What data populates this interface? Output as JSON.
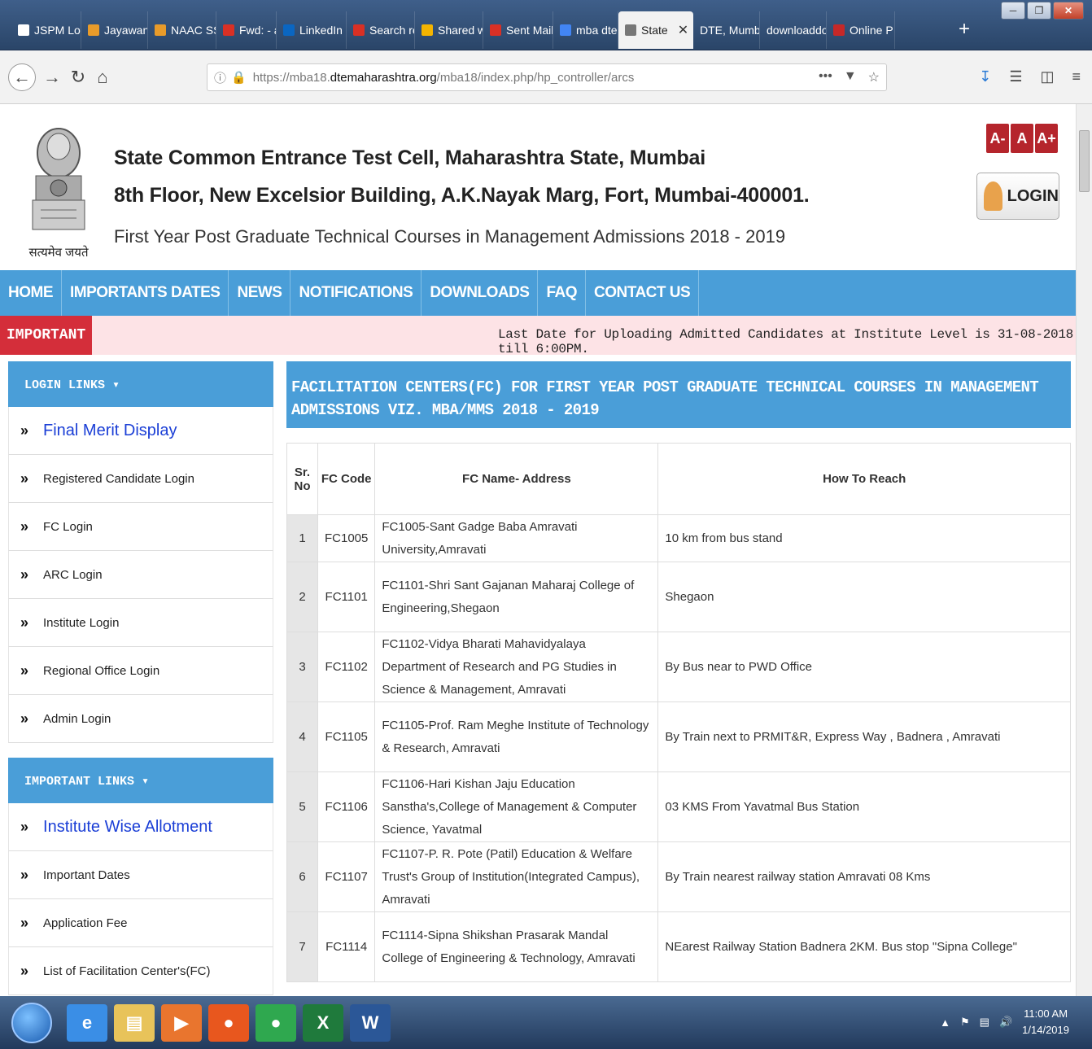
{
  "browser": {
    "tabs": [
      {
        "label": "JSPM Login P",
        "icon": "page-icon",
        "color": "#ffffff"
      },
      {
        "label": "Jayawant",
        "icon": "jayawant-logo-icon",
        "color": "#e89b2a"
      },
      {
        "label": "NAAC SS",
        "icon": "naac-logo-icon",
        "color": "#e89b2a"
      },
      {
        "label": "Fwd: - ad",
        "icon": "gmail-icon",
        "color": "#d93025"
      },
      {
        "label": "LinkedIn",
        "icon": "linkedin-icon",
        "color": "#0a66c2"
      },
      {
        "label": "Search re",
        "icon": "gmail-icon",
        "color": "#d93025"
      },
      {
        "label": "Shared w",
        "icon": "google-drive-icon",
        "color": "#f4b400"
      },
      {
        "label": "Sent Mail",
        "icon": "gmail-icon",
        "color": "#d93025"
      },
      {
        "label": "mba dte",
        "icon": "google-icon",
        "color": "#4285f4"
      },
      {
        "label": "State",
        "icon": "emblem-icon",
        "color": "#777777",
        "active": true
      },
      {
        "label": "DTE, Mumba",
        "icon": "",
        "color": ""
      },
      {
        "label": "downloaddo",
        "icon": "",
        "color": ""
      },
      {
        "label": "Online PI",
        "icon": "pdf-icon",
        "color": "#c62828"
      }
    ],
    "new_tab": "+",
    "url": {
      "prefix": "https://mba18.",
      "host": "dtemaharashtra.org",
      "suffix": "/mba18/index.php/hp_controller/arcs",
      "more": "•••"
    }
  },
  "page": {
    "title_line1": "State Common Entrance Test Cell, Maharashtra State, Mumbai",
    "title_line2": "8th Floor, New Excelsior Building, A.K.Nayak Marg, Fort, Mumbai-400001.",
    "title_line3": "First Year Post Graduate Technical Courses in Management Admissions 2018 - 2019",
    "emblem_motto": "सत्यमेव जयते",
    "font_buttons": [
      "A-",
      "A",
      "A+"
    ],
    "login_label": "LOGIN",
    "menu": [
      "HOME",
      "IMPORTANTS DATES",
      "NEWS",
      "NOTIFICATIONS",
      "DOWNLOADS",
      "FAQ",
      "CONTACT US"
    ],
    "important_label": "IMPORTANT",
    "important_text": "Last Date for Uploading Admitted Candidates at Institute Level is 31-08-2018 till 6:00PM.",
    "colors": {
      "accent": "#4a9ed8",
      "alert": "#d42e3a",
      "alert_bg": "#fde3e6",
      "link": "#1a3ed6"
    }
  },
  "sidebar": {
    "login_header": "LOGIN LINKS ▾",
    "login_links": [
      {
        "label": "Final Merit Display",
        "big": true
      },
      {
        "label": "Registered Candidate Login"
      },
      {
        "label": "FC Login"
      },
      {
        "label": "ARC Login"
      },
      {
        "label": "Institute Login"
      },
      {
        "label": "Regional Office Login"
      },
      {
        "label": "Admin Login"
      }
    ],
    "important_header": "IMPORTANT LINKS ▾",
    "important_links": [
      {
        "label": "Institute Wise Allotment",
        "big": true
      },
      {
        "label": "Important Dates"
      },
      {
        "label": "Application Fee"
      },
      {
        "label": "List of Facilitation Center's(FC)"
      }
    ]
  },
  "main": {
    "heading": "FACILITATION CENTERS(FC) FOR FIRST YEAR POST GRADUATE TECHNICAL COURSES IN MANAGEMENT ADMISSIONS VIZ. MBA/MMS 2018 - 2019",
    "columns": [
      "Sr. No",
      "FC Code",
      "FC Name- Address",
      "How To Reach"
    ],
    "rows": [
      {
        "sr": "1",
        "code": "FC1005",
        "name": "FC1005-Sant Gadge Baba Amravati University,Amravati",
        "reach": "10 km from bus stand"
      },
      {
        "sr": "2",
        "code": "FC1101",
        "name": "FC1101-Shri Sant Gajanan Maharaj College of Engineering,Shegaon",
        "reach": "Shegaon"
      },
      {
        "sr": "3",
        "code": "FC1102",
        "name": "FC1102-Vidya Bharati Mahavidyalaya Department of Research and PG Studies in Science & Management, Amravati",
        "reach": "By Bus near to PWD Office"
      },
      {
        "sr": "4",
        "code": "FC1105",
        "name": "FC1105-Prof. Ram Meghe Institute of Technology & Research, Amravati",
        "reach": "By Train next to PRMIT&R, Express Way , Badnera , Amravati"
      },
      {
        "sr": "5",
        "code": "FC1106",
        "name": "FC1106-Hari Kishan Jaju Education Sanstha's,College of Management & Computer Science, Yavatmal",
        "reach": "03 KMS From Yavatmal Bus Station"
      },
      {
        "sr": "6",
        "code": "FC1107",
        "name": "FC1107-P. R. Pote (Patil) Education & Welfare Trust's Group of Institution(Integrated Campus), Amravati",
        "reach": "By Train nearest railway station Amravati 08 Kms"
      },
      {
        "sr": "7",
        "code": "FC1114",
        "name": "FC1114-Sipna Shikshan Prasarak Mandal College of Engineering & Technology, Amravati",
        "reach": "NEarest Railway Station Badnera 2KM. Bus stop \"Sipna College\""
      }
    ]
  },
  "taskbar": {
    "apps": [
      {
        "name": "ie-icon",
        "color": "#3a8ee6",
        "glyph": "e"
      },
      {
        "name": "file-explorer-icon",
        "color": "#e8c35a",
        "glyph": "▤"
      },
      {
        "name": "media-player-icon",
        "color": "#e9752e",
        "glyph": "▶"
      },
      {
        "name": "firefox-icon",
        "color": "#e8571e",
        "glyph": "●"
      },
      {
        "name": "chrome-icon",
        "color": "#2fa84f",
        "glyph": "●"
      },
      {
        "name": "excel-icon",
        "color": "#1f7a3c",
        "glyph": "X"
      },
      {
        "name": "word-icon",
        "color": "#2b5797",
        "glyph": "W"
      }
    ],
    "time": "11:00 AM",
    "date": "1/14/2019"
  }
}
